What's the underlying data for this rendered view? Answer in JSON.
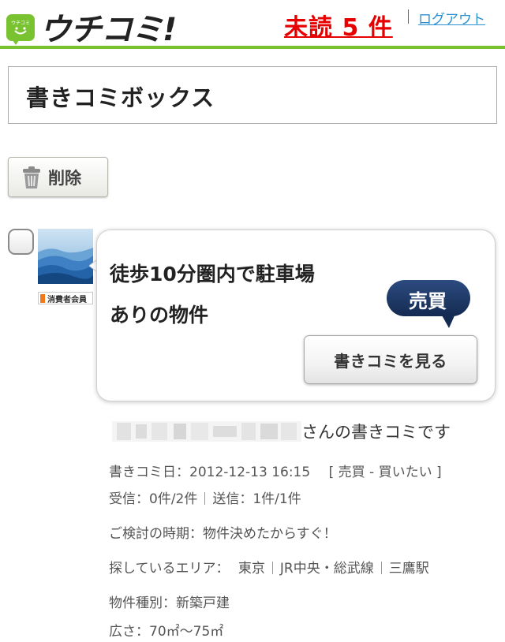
{
  "header": {
    "logo_text": "ウチコミ!",
    "logo_badge_text": "ウチコミ",
    "unread_label": "未読 5 件",
    "logout_label": "ログアウト"
  },
  "page": {
    "title": "書きコミボックス"
  },
  "toolbar": {
    "delete_label": "削除"
  },
  "item": {
    "member_badge": "消費者会員",
    "title_line1": "徒歩10分圏内で駐車場",
    "title_line2": "ありの物件",
    "deal_type": "売買",
    "view_button": "書きコミを見る",
    "author_suffix": "さんの書きコミです",
    "date": "書きコミ日：2012-12-13 16:15",
    "deal_note": "[ 売買 - 買いたい ]",
    "received": "受信：0件/2件",
    "sent": "送信：1件/1件",
    "timing": "ご検討の時期：物件決めたからすぐ！",
    "area_label": "探しているエリア：",
    "area_pref": "東京",
    "area_line": "JR中央・総武線",
    "area_station": "三鷹駅",
    "property_type": "物件種別：新築戸建",
    "size": "広さ：70㎡～75㎡"
  },
  "colors": {
    "brand_green": "#79c330",
    "unread_red": "#e60000",
    "link_blue": "#2a8fd0",
    "deal_badge_navy": "#1f3a66"
  }
}
